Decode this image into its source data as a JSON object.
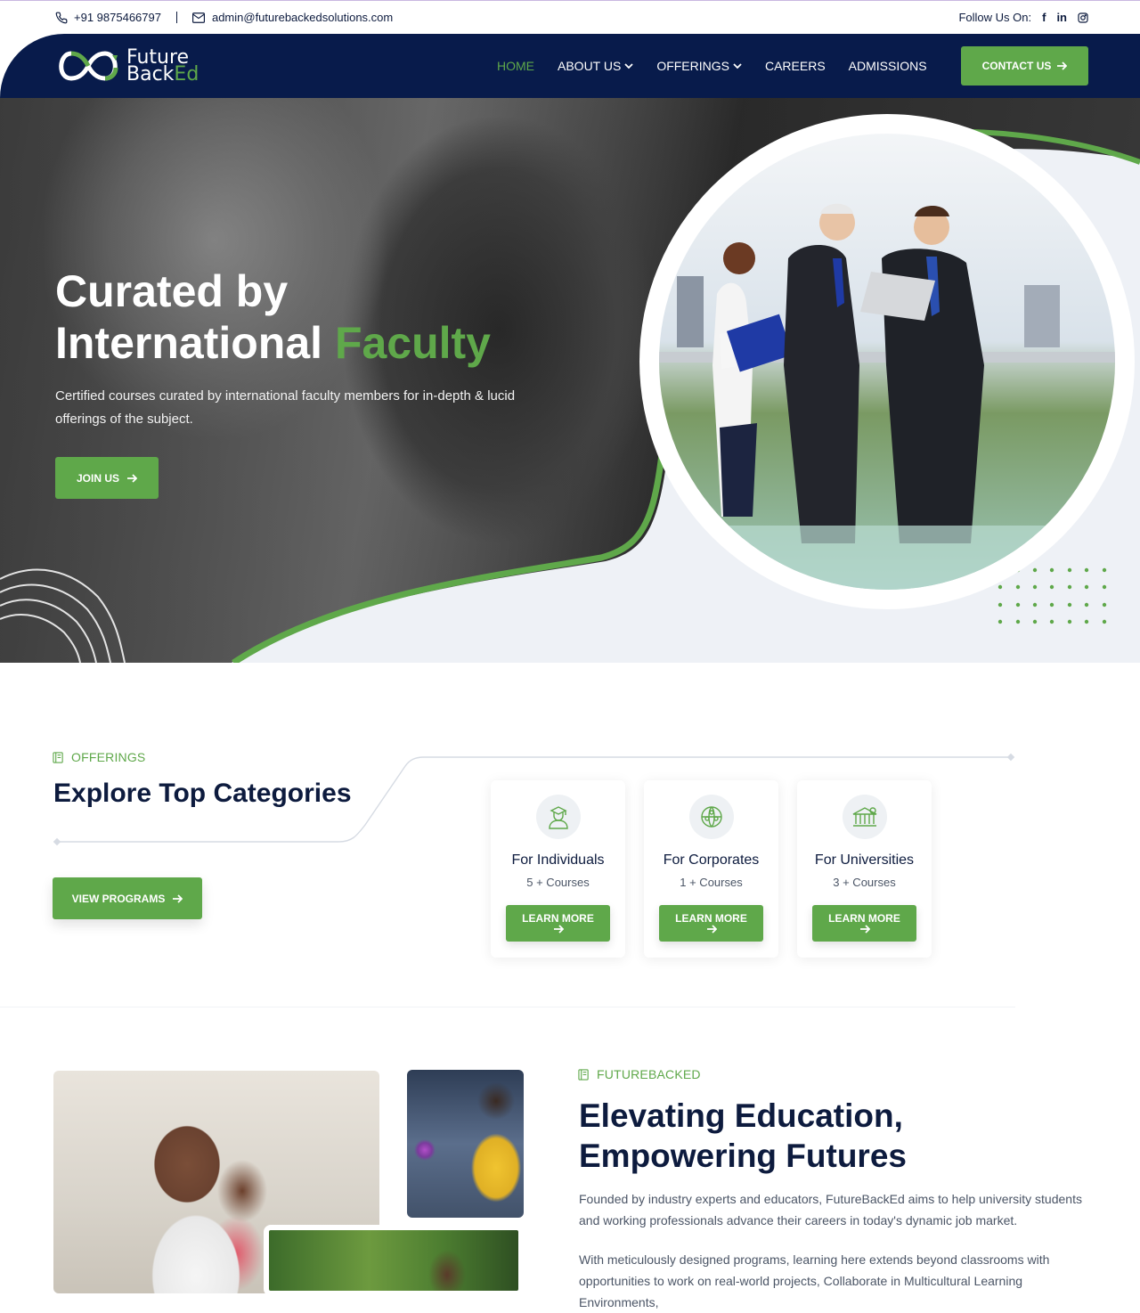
{
  "topbar": {
    "phone": "+91 9875466797",
    "email": "admin@futurebackedsolutions.com",
    "follow_label": "Follow Us On:",
    "social_icons": [
      "facebook-icon",
      "linkedin-icon",
      "instagram-icon"
    ]
  },
  "brand": {
    "logo_line1": "Future",
    "logo_line2a": "Back",
    "logo_line2b": "Ed",
    "colors": {
      "navy": "#081b4b",
      "green": "#5fa84a",
      "text": "#0d1b3e"
    }
  },
  "nav": {
    "items": [
      {
        "label": "HOME",
        "active": true,
        "dropdown": false
      },
      {
        "label": "ABOUT US",
        "active": false,
        "dropdown": true
      },
      {
        "label": "OFFERINGS",
        "active": false,
        "dropdown": true
      },
      {
        "label": "CAREERS",
        "active": false,
        "dropdown": false
      },
      {
        "label": "ADMISSIONS",
        "active": false,
        "dropdown": false
      }
    ],
    "contact_label": "CONTACT US"
  },
  "hero": {
    "title_line1": "Curated by",
    "title_line2a": "International",
    "title_line2b": "Faculty",
    "subtitle": "Certified courses curated by international faculty members for in-depth & lucid offerings of the subject.",
    "cta": "JOIN US"
  },
  "offerings": {
    "tag": "OFFERINGS",
    "title": "Explore Top Categories",
    "view_button": "VIEW PROGRAMS",
    "cards": [
      {
        "title": "For Individuals",
        "count": "5 + Courses",
        "button": "LEARN MORE",
        "icon": "graduate-icon"
      },
      {
        "title": "For Corporates",
        "count": "1 + Courses",
        "button": "LEARN MORE",
        "icon": "corporate-globe-icon"
      },
      {
        "title": "For Universities",
        "count": "3 + Courses",
        "button": "LEARN MORE",
        "icon": "university-icon"
      }
    ]
  },
  "about": {
    "tag": "FUTUREBACKED",
    "title_line1": "Elevating Education,",
    "title_line2": "Empowering Futures",
    "para1": "Founded by industry experts and educators, FutureBackEd aims to help university students and working professionals advance their careers in today's dynamic job market.",
    "para2": "With meticulously designed programs, learning here extends beyond classrooms with opportunities to work on real-world projects, Collaborate in Multicultural Learning Environments,"
  }
}
